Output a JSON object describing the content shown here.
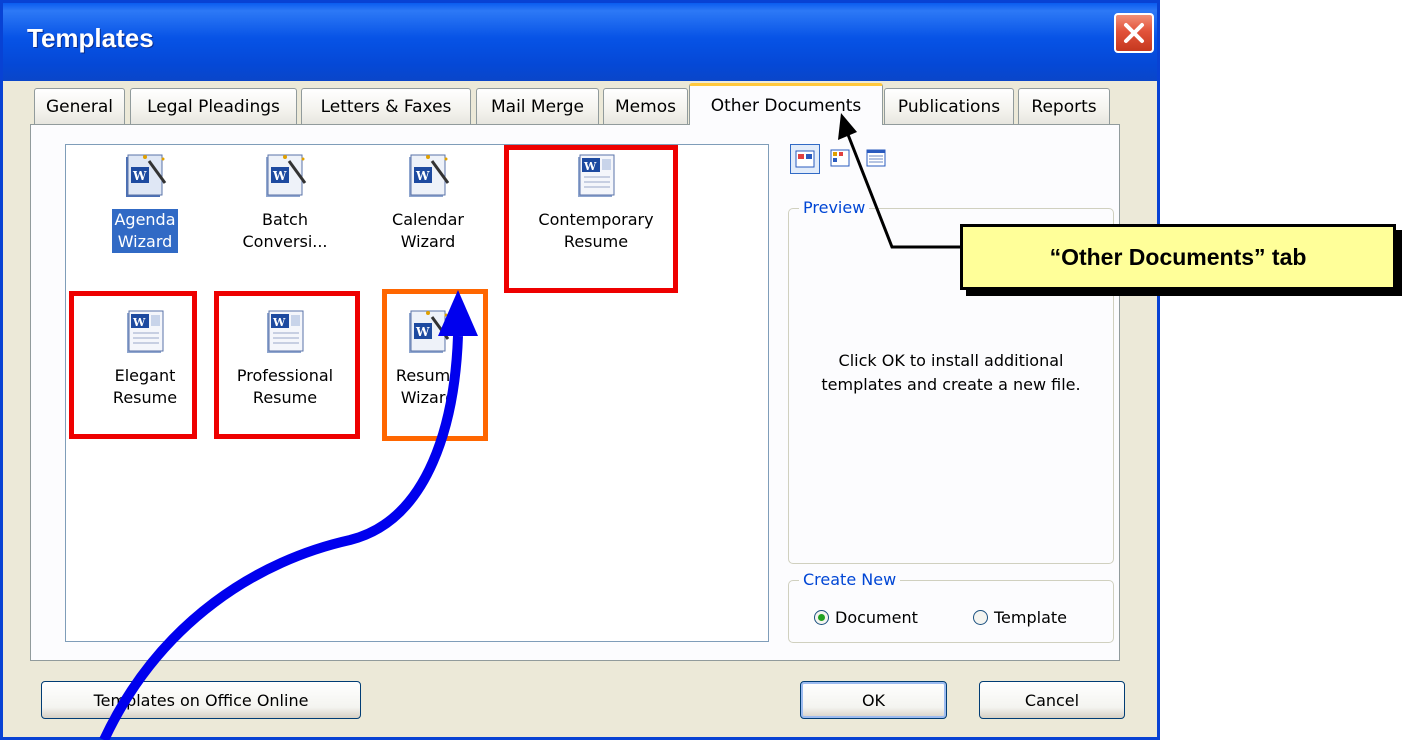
{
  "dialog": {
    "title": "Templates",
    "tabs": [
      {
        "label": "General"
      },
      {
        "label": "Legal Pleadings"
      },
      {
        "label": "Letters & Faxes"
      },
      {
        "label": "Mail Merge"
      },
      {
        "label": "Memos"
      },
      {
        "label": "Other Documents",
        "active": true
      },
      {
        "label": "Publications"
      },
      {
        "label": "Reports"
      }
    ],
    "templates": [
      {
        "line1": "Agenda",
        "line2": "Wizard",
        "icon": "word-wizard-icon",
        "selected": true
      },
      {
        "line1": "Batch",
        "line2": "Conversi...",
        "icon": "word-wizard-icon"
      },
      {
        "line1": "Calendar",
        "line2": "Wizard",
        "icon": "word-wizard-icon"
      },
      {
        "line1": "Contemporary",
        "line2": "Resume",
        "icon": "word-document-icon"
      },
      {
        "line1": "Elegant",
        "line2": "Resume",
        "icon": "word-document-icon"
      },
      {
        "line1": "Professional",
        "line2": "Resume",
        "icon": "word-document-icon"
      },
      {
        "line1": "Resume",
        "line2": "Wizard",
        "icon": "word-wizard-icon"
      }
    ],
    "view_buttons": [
      "large-icons-view-icon",
      "list-view-icon",
      "details-view-icon"
    ],
    "preview": {
      "title": "Preview",
      "message_line1": "Click OK to install additional",
      "message_line2": "templates and create a new file."
    },
    "create_new": {
      "title": "Create New",
      "options": [
        {
          "label": "Document",
          "selected": true
        },
        {
          "label": "Template",
          "selected": false
        }
      ]
    },
    "buttons": {
      "online": "Templates on Office Online",
      "ok": "OK",
      "cancel": "Cancel"
    }
  },
  "annotations": {
    "callout_text": "“Other Documents” tab",
    "colors": {
      "red_box": "#ee0000",
      "orange_box": "#ff6600",
      "blue_arrow": "#0000ee",
      "callout_fill": "#ffff99"
    }
  }
}
